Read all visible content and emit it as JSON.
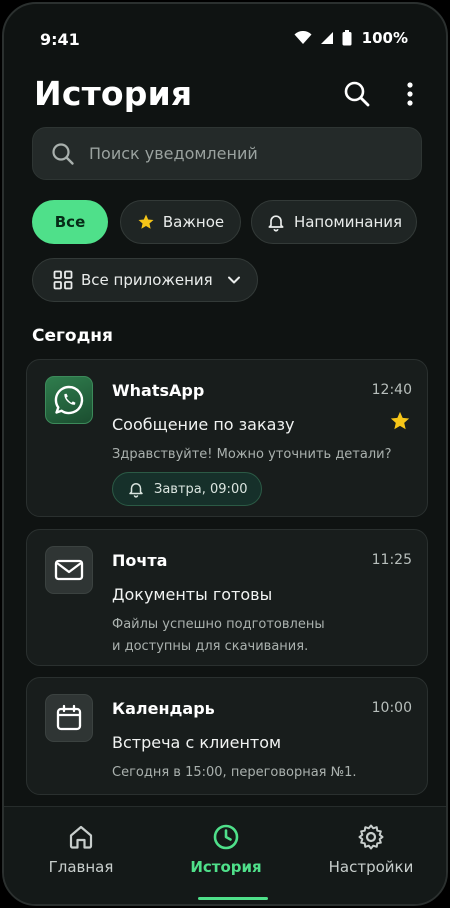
{
  "status_bar": {
    "time": "9:41",
    "battery": "100%"
  },
  "header": {
    "title": "История"
  },
  "search": {
    "placeholder": "Поиск уведомлений"
  },
  "filters": {
    "all": "Все",
    "important": "Важное",
    "reminders": "Напоминания",
    "apps": "Все приложения"
  },
  "section": {
    "today": "Сегодня"
  },
  "notifications": [
    {
      "app": "WhatsApp",
      "time": "12:40",
      "title": "Сообщение по заказу",
      "body": "Здравствуйте! Можно уточнить детали?",
      "starred": true,
      "reminder": "Завтра, 09:00"
    },
    {
      "app": "Почта",
      "time": "11:25",
      "title": "Документы готовы",
      "body_line1": "Файлы успешно подготовлены",
      "body_line2": "и доступны для скачивания."
    },
    {
      "app": "Календарь",
      "time": "10:00",
      "title": "Встреча с клиентом",
      "body": "Сегодня в 15:00, переговорная №1."
    }
  ],
  "bottom_nav": {
    "home": "Главная",
    "history": "История",
    "settings": "Настройки",
    "active": "history"
  },
  "colors": {
    "accent": "#4fe08a",
    "background": "#0f1312",
    "star": "#f5c518"
  }
}
